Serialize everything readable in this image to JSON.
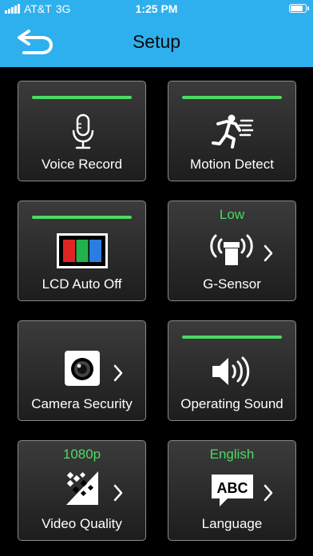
{
  "status_bar": {
    "carrier": "AT&T",
    "network": "3G",
    "time": "1:25 PM"
  },
  "header": {
    "title": "Setup",
    "back_icon": "back-arrow-icon"
  },
  "accent_color": "#2fb0ee",
  "active_color": "#4cd964",
  "tiles": [
    {
      "label": "Voice Record",
      "icon": "microphone-icon",
      "enabled": true
    },
    {
      "label": "Motion Detect",
      "icon": "running-man-icon",
      "enabled": true
    },
    {
      "label": "LCD Auto Off",
      "icon": "lcd-color-bars-icon",
      "enabled": true
    },
    {
      "label": "G-Sensor",
      "icon": "g-sensor-icon",
      "value": "Low"
    },
    {
      "label": "Camera Security",
      "icon": "camera-lens-icon"
    },
    {
      "label": "Operating Sound",
      "icon": "speaker-icon",
      "enabled": true
    },
    {
      "label": "Video Quality",
      "icon": "video-quality-icon",
      "value": "1080p"
    },
    {
      "label": "Language",
      "icon": "abc-speech-icon",
      "value": "English"
    }
  ]
}
